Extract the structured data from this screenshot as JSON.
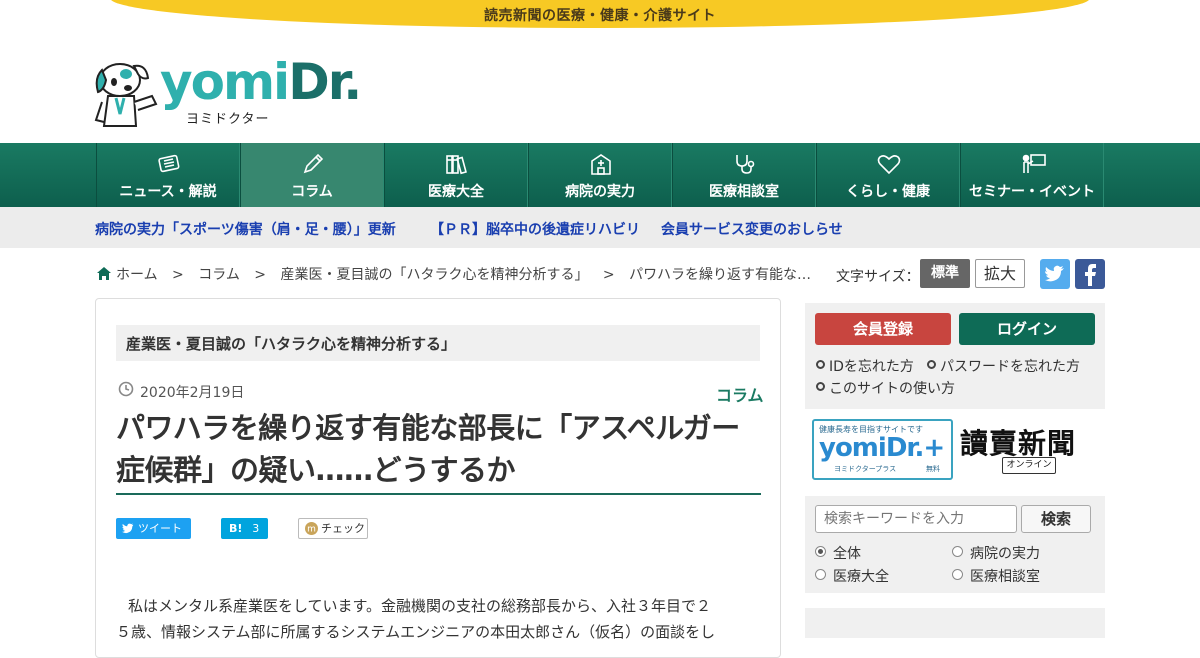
{
  "site": {
    "tagline": "読売新聞の医療・健康・介護サイト",
    "logo_word_y": "yomi",
    "logo_word_d": "Dr.",
    "logo_sub": "ヨミドクター"
  },
  "nav": [
    {
      "label": "ニュース・解説",
      "icon": "news-icon"
    },
    {
      "label": "コラム",
      "icon": "pencil-icon",
      "active": true
    },
    {
      "label": "医療大全",
      "icon": "books-icon"
    },
    {
      "label": "病院の実力",
      "icon": "hospital-icon"
    },
    {
      "label": "医療相談室",
      "icon": "stethoscope-icon"
    },
    {
      "label": "くらし・健康",
      "icon": "heart-icon"
    },
    {
      "label": "セミナー・イベント",
      "icon": "presenter-icon"
    }
  ],
  "news": [
    "病院の実力「スポーツ傷害（肩・足・腰）」更新",
    "【ＰＲ】脳卒中の後遺症リハビリ",
    "会員サービス変更のおしらせ"
  ],
  "breadcrumb": [
    "ホーム",
    ">",
    "コラム",
    ">",
    "産業医・夏目誠の「ハタラク心を精神分析する」",
    ">",
    "パワハラを繰り返す有能な…"
  ],
  "font_size": {
    "label": "文字サイズ：",
    "standard": "標準",
    "large": "拡大"
  },
  "article": {
    "series": "産業医・夏目誠の「ハタラク心を精神分析する」",
    "date": "2020年2月19日",
    "category": "コラム",
    "title": "パワハラを繰り返す有能な部長に「アスペルガー症候群」の疑い……どうするか",
    "share": {
      "tweet": "ツイート",
      "hatena_logo": "B!",
      "hatena_count": "3",
      "check": "チェック"
    },
    "body_line1": "私はメンタル系産業医をしています。金融機関の支社の総務部長から、入社３年目で２",
    "body_line2": "５歳、情報システム部に所属するシステムエンジニアの本田太郎さん（仮名）の面談をし"
  },
  "sidebar": {
    "register": "会員登録",
    "login": "ログイン",
    "forgot_id": "IDを忘れた方",
    "forgot_pw": "パスワードを忘れた方",
    "howto": "このサイトの使い方",
    "plus_top": "健康長寿を目指すサイトです",
    "plus_word": "yomiDr.+",
    "plus_sub": "ヨミドクタープラス",
    "plus_free": "無料",
    "yomiuri": "讀賣新聞",
    "yomiuri_online": "オンライン",
    "search_placeholder": "検索キーワードを入力",
    "search_button": "検索",
    "scopes": [
      {
        "label": "全体",
        "selected": true
      },
      {
        "label": "病院の実力",
        "selected": false
      },
      {
        "label": "医療大全",
        "selected": false
      },
      {
        "label": "医療相談室",
        "selected": false
      }
    ]
  },
  "colors": {
    "brand_green": "#0e6b56",
    "accent_yellow": "#f7c924",
    "link_blue": "#1a3fb0",
    "register_red": "#c8453f"
  }
}
